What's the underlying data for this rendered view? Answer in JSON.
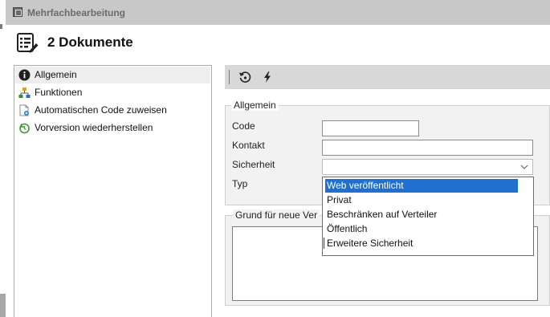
{
  "window": {
    "title": "Mehrfachbearbeitung"
  },
  "header": {
    "title": "2 Dokumente"
  },
  "tree": {
    "items": [
      {
        "label": "Allgemein",
        "icon": "info-icon"
      },
      {
        "label": "Funktionen",
        "icon": "hierarchy-icon"
      },
      {
        "label": "Automatischen Code zuweisen",
        "icon": "document-code-icon"
      },
      {
        "label": "Vorversion wiederherstellen",
        "icon": "restore-icon"
      }
    ],
    "selected_index": 0
  },
  "toolbar": {
    "buttons": [
      "restore-icon",
      "lightning-icon"
    ]
  },
  "form": {
    "group_general": "Allgemein",
    "fields": {
      "code": {
        "label": "Code",
        "value": ""
      },
      "kontakt": {
        "label": "Kontakt",
        "value": ""
      },
      "sicherheit": {
        "label": "Sicherheit",
        "value": ""
      },
      "typ": {
        "label": "Typ"
      }
    },
    "group_reason": "Grund für neue Ver",
    "reason_value": ""
  },
  "dropdown": {
    "options": [
      "Web veröffentlicht",
      "Privat",
      "Beschränken auf Verteiler",
      "Öffentlich",
      "Erweitere Sicherheit"
    ],
    "selected_index": 0
  },
  "colors": {
    "selection": "#1e6fd0",
    "titlebar": "#c8c8c8",
    "toolbar": "#d8d8d8"
  }
}
